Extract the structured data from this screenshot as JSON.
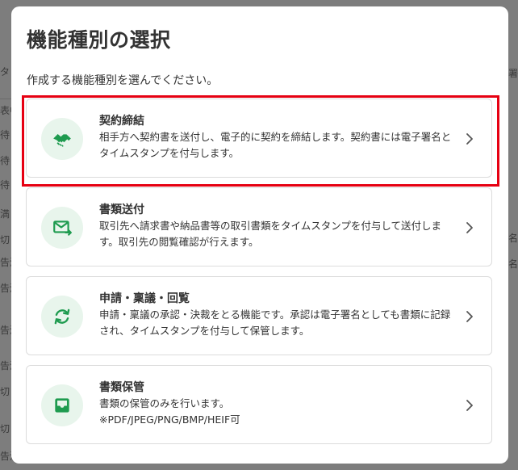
{
  "background": {
    "left_fragments": [
      "タ",
      "表中",
      "待",
      "待",
      "待",
      "満",
      "切",
      "告済",
      "告済",
      "告済",
      "告済",
      "切",
      "切",
      "告済"
    ],
    "right_fragments": [
      "署",
      "署名",
      "署名"
    ]
  },
  "modal": {
    "title": "機能種別の選択",
    "subtitle": "作成する機能種別を選んでください。",
    "accent_color": "#1e9b4f",
    "highlight_color": "#e60012",
    "options": [
      {
        "title": "契約締結",
        "desc": "相手方へ契約書を送付し、電子的に契約を締結します。契約書には電子署名とタイムスタンプを付与します。",
        "icon": "handshake-icon"
      },
      {
        "title": "書類送付",
        "desc": "取引先へ請求書や納品書等の取引書類をタイムスタンプを付与して送付します。取引先の閲覧確認が行えます。",
        "icon": "mail-send-icon"
      },
      {
        "title": "申請・稟議・回覧",
        "desc": "申請・稟議の承認・決裁をとる機能です。承認は電子署名としても書類に記録され、タイムスタンプを付与して保管します。",
        "icon": "refresh-cycle-icon"
      },
      {
        "title": "書類保管",
        "desc": "書類の保管のみを行います。",
        "desc2": "※PDF/JPEG/PNG/BMP/HEIF可",
        "icon": "inbox-tray-icon"
      }
    ]
  }
}
